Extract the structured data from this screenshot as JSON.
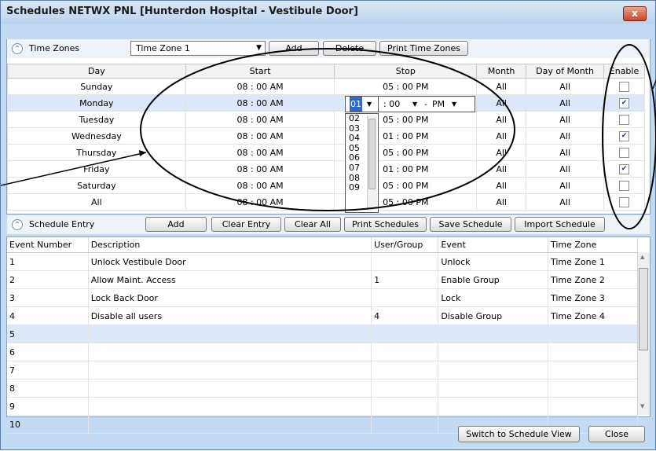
{
  "window": {
    "title": "Schedules NETWX PNL [Hunterdon Hospital - Vestibule Door]",
    "close": "x"
  },
  "timezones": {
    "label": "Time Zones",
    "selected": "Time Zone 1",
    "buttons": {
      "add": "Add",
      "delete": "Delete",
      "print": "Print Time Zones"
    },
    "headers": [
      "Day",
      "Start",
      "Stop",
      "Month",
      "Day of Month",
      "Enable"
    ],
    "rows": [
      {
        "day": "Sunday",
        "start": "08 : 00 AM",
        "stop": "05 : 00 PM",
        "month": "All",
        "dom": "All",
        "enable": false
      },
      {
        "day": "Monday",
        "start": "08 : 00 AM",
        "stop": "",
        "month": "All",
        "dom": "All",
        "enable": true
      },
      {
        "day": "Tuesday",
        "start": "08 : 00 AM",
        "stop": "05 : 00 PM",
        "month": "All",
        "dom": "All",
        "enable": false
      },
      {
        "day": "Wednesday",
        "start": "08 : 00 AM",
        "stop": "01 : 00 PM",
        "month": "All",
        "dom": "All",
        "enable": true
      },
      {
        "day": "Thursday",
        "start": "08 : 00 AM",
        "stop": "05 : 00 PM",
        "month": "All",
        "dom": "All",
        "enable": false
      },
      {
        "day": "Friday",
        "start": "08 : 00 AM",
        "stop": "01 : 00 PM",
        "month": "All",
        "dom": "All",
        "enable": true
      },
      {
        "day": "Saturday",
        "start": "08 : 00 AM",
        "stop": "05 : 00 PM",
        "month": "All",
        "dom": "All",
        "enable": false
      },
      {
        "day": "All",
        "start": "08 : 00 AM",
        "stop": "05 : 00 PM",
        "month": "All",
        "dom": "All",
        "enable": false
      }
    ],
    "editor": {
      "hour": "01",
      "minute": ": 00",
      "dash": "-",
      "ampm": "PM"
    },
    "hour_options": [
      "02",
      "03",
      "04",
      "05",
      "06",
      "07",
      "08",
      "09"
    ]
  },
  "schedule": {
    "label": "Schedule Entry",
    "buttons": {
      "add": "Add",
      "clear_entry": "Clear Entry",
      "clear_all": "Clear All",
      "print": "Print Schedules",
      "save": "Save Schedule",
      "import": "Import Schedule"
    },
    "headers": [
      "Event Number",
      "Description",
      "User/Group",
      "Event",
      "Time Zone"
    ],
    "rows": [
      {
        "num": "1",
        "desc": "Unlock Vestibule Door",
        "user": "",
        "event": "Unlock",
        "tz": "Time Zone 1"
      },
      {
        "num": "2",
        "desc": "Allow Maint. Access",
        "user": "1",
        "event": "Enable Group",
        "tz": "Time Zone 2"
      },
      {
        "num": "3",
        "desc": "Lock Back Door",
        "user": "",
        "event": "Lock",
        "tz": "Time Zone 3"
      },
      {
        "num": "4",
        "desc": "Disable all users",
        "user": "4",
        "event": "Disable Group",
        "tz": "Time Zone 4"
      },
      {
        "num": "5",
        "desc": "",
        "user": "",
        "event": "",
        "tz": ""
      },
      {
        "num": "6",
        "desc": "",
        "user": "",
        "event": "",
        "tz": ""
      },
      {
        "num": "7",
        "desc": "",
        "user": "",
        "event": "",
        "tz": ""
      },
      {
        "num": "8",
        "desc": "",
        "user": "",
        "event": "",
        "tz": ""
      },
      {
        "num": "9",
        "desc": "",
        "user": "",
        "event": "",
        "tz": ""
      },
      {
        "num": "10",
        "desc": "",
        "user": "",
        "event": "",
        "tz": ""
      }
    ]
  },
  "footer": {
    "switch": "Switch to Schedule View",
    "close": "Close"
  },
  "colors": {
    "accent": "#c4daf2",
    "selected_row": "#dce8f8",
    "close_button": "#c8462a"
  }
}
